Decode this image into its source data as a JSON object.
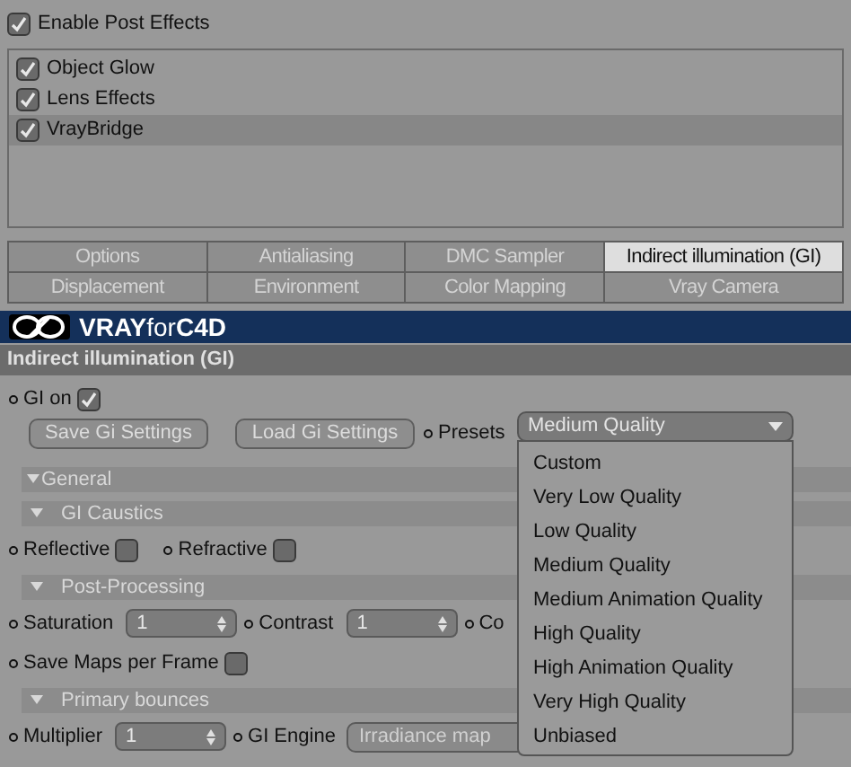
{
  "enable_post_effects": {
    "label": "Enable Post Effects",
    "checked": true
  },
  "effects": [
    {
      "label": "Object Glow",
      "checked": true,
      "selected": false
    },
    {
      "label": "Lens Effects",
      "checked": true,
      "selected": false
    },
    {
      "label": "VrayBridge",
      "checked": true,
      "selected": true
    }
  ],
  "tabs": [
    {
      "label": "Options",
      "selected": false
    },
    {
      "label": "Antialiasing",
      "selected": false
    },
    {
      "label": "DMC Sampler",
      "selected": false
    },
    {
      "label": "Indirect illumination (GI)",
      "selected": true
    },
    {
      "label": "Displacement",
      "selected": false
    },
    {
      "label": "Environment",
      "selected": false
    },
    {
      "label": "Color Mapping",
      "selected": false
    },
    {
      "label": "Vray Camera",
      "selected": false
    }
  ],
  "banner": {
    "brand_bold": "VRAY",
    "brand_light": "for",
    "brand_end": "C4D"
  },
  "section_title": "Indirect illumination (GI)",
  "gi_on": {
    "label": "GI on",
    "checked": true
  },
  "buttons": [
    "Save Gi Settings",
    "Load Gi Settings"
  ],
  "presets": {
    "label": "Presets",
    "value": "Medium Quality",
    "expanded": true,
    "options": [
      "Custom",
      "Very Low Quality",
      "Low Quality",
      "Medium Quality",
      "Medium Animation Quality",
      "High Quality",
      "High Animation Quality",
      "Very High Quality",
      "Unbiased"
    ]
  },
  "groups": [
    {
      "title": "General",
      "expanded": true,
      "children": [
        {
          "title": "GI Caustics",
          "expanded": true,
          "rows": [
            [
              {
                "kind": "checkbox",
                "label": "Reflective",
                "checked": false
              },
              {
                "kind": "checkbox",
                "label": "Refractive",
                "checked": false
              }
            ]
          ]
        },
        {
          "title": "Post-Processing",
          "expanded": true,
          "rows": [
            [
              {
                "kind": "number",
                "label": "Saturation",
                "value": "1"
              },
              {
                "kind": "number",
                "label": "Contrast",
                "value": "1"
              },
              {
                "kind": "label",
                "label": "Co"
              }
            ],
            [
              {
                "kind": "checkbox",
                "label": "Save Maps per Frame",
                "checked": false
              }
            ]
          ]
        },
        {
          "title": "Primary bounces",
          "expanded": true,
          "rows": [
            [
              {
                "kind": "number",
                "label": "Multiplier",
                "value": "1"
              },
              {
                "kind": "dropdown",
                "label": "GI Engine",
                "value": "Irradiance map"
              }
            ]
          ]
        }
      ]
    }
  ]
}
